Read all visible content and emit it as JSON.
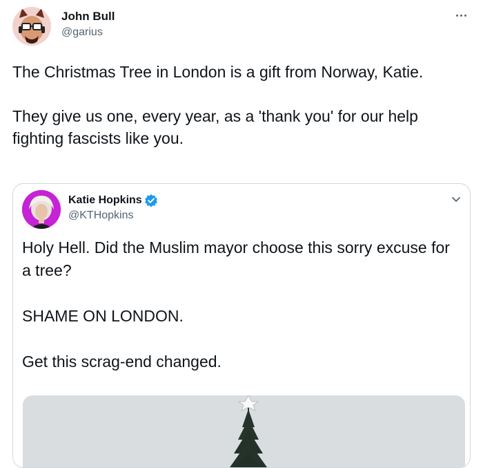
{
  "tweet": {
    "author": {
      "name": "John Bull",
      "handle": "@garius"
    },
    "more_icon": "more-horizontal-icon",
    "text": "The Christmas Tree in London is a gift from Norway, Katie.\n\nThey give us one, every year, as a 'thank you' for our help fighting fascists like you.",
    "quoted": {
      "author": {
        "name": "Katie Hopkins",
        "handle": "@KTHopkins",
        "verified": true
      },
      "menu_icon": "chevron-down-icon",
      "text": "Holy Hell. Did the Muslim mayor choose this sorry excuse for a tree?\n\nSHAME ON LONDON.\n\nGet this scrag-end changed."
    }
  },
  "colors": {
    "text": "#0f1419",
    "secondary": "#536471",
    "border": "#cfd9de",
    "verified": "#1d9bf0",
    "quoted_avatar_bg": "#c622d6"
  }
}
